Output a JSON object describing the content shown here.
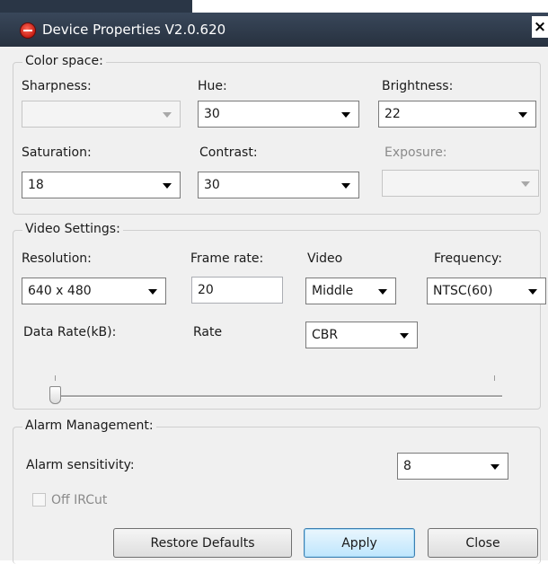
{
  "window": {
    "title": "Device Properties V2.0.620",
    "close_label": "×"
  },
  "color_space": {
    "legend": "Color space:",
    "sharpness": {
      "label": "Sharpness:",
      "value": ""
    },
    "hue": {
      "label": "Hue:",
      "value": "30"
    },
    "brightness": {
      "label": "Brightness:",
      "value": "22"
    },
    "saturation": {
      "label": "Saturation:",
      "value": "18"
    },
    "contrast": {
      "label": "Contrast:",
      "value": "30"
    },
    "exposure": {
      "label": "Exposure:",
      "value": ""
    }
  },
  "video_settings": {
    "legend": "Video Settings:",
    "resolution": {
      "label": "Resolution:",
      "value": "640 x 480"
    },
    "frame_rate": {
      "label": "Frame rate:",
      "value": "20"
    },
    "video": {
      "label": "Video",
      "value": "Middle"
    },
    "frequency": {
      "label": "Frequency:",
      "value": "NTSC(60)"
    },
    "data_rate": {
      "label": "Data Rate(kB):",
      "slider_position": 0
    },
    "rate": {
      "label": "Rate",
      "value": "CBR"
    }
  },
  "alarm": {
    "legend": "Alarm Management:",
    "sensitivity": {
      "label": "Alarm sensitivity:",
      "value": "8"
    },
    "off_ircut": {
      "label": "Off IRCut",
      "checked": false
    }
  },
  "buttons": {
    "restore": "Restore Defaults",
    "apply": "Apply",
    "close": "Close"
  }
}
